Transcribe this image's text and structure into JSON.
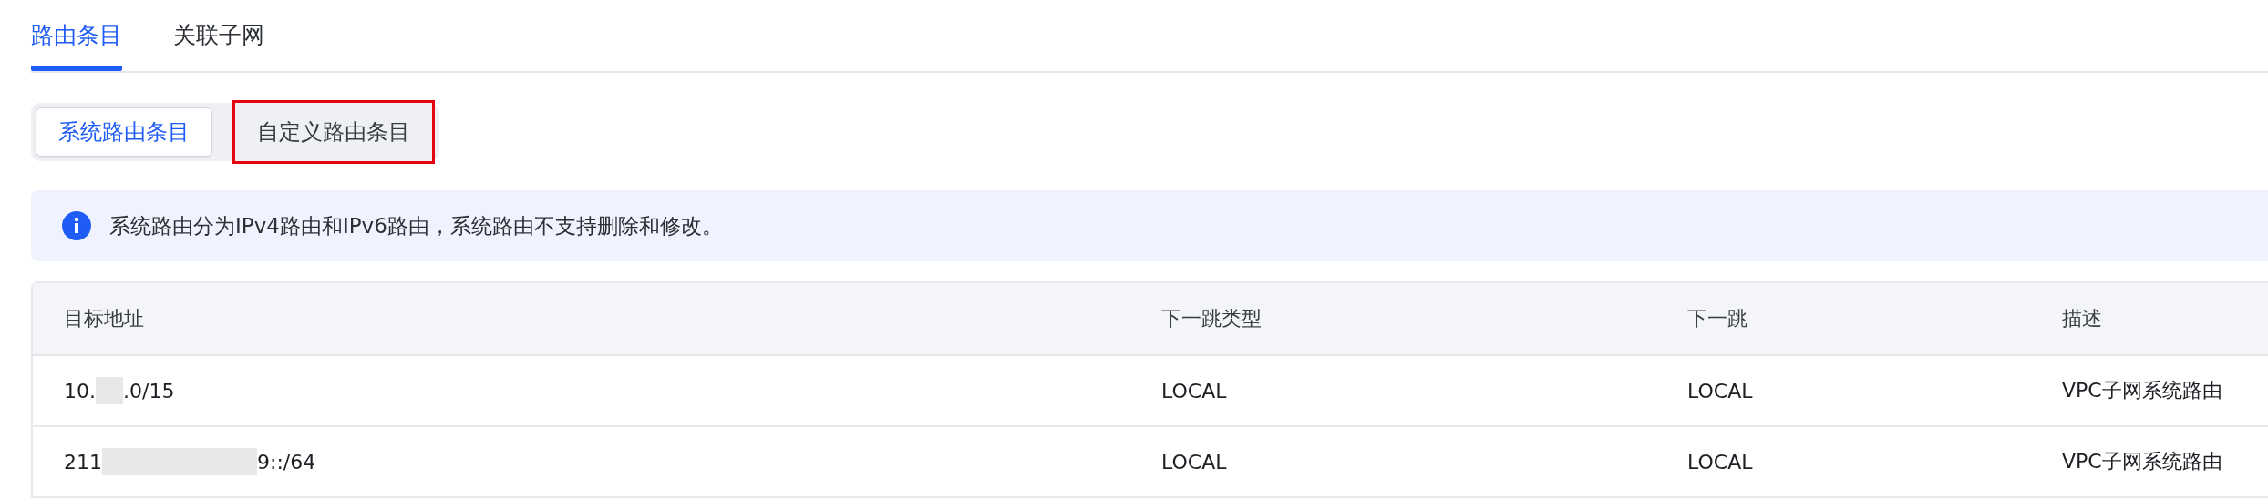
{
  "tabs": [
    {
      "label": "路由条目",
      "selected": true
    },
    {
      "label": "关联子网",
      "selected": false
    }
  ],
  "segments": [
    {
      "label": "系统路由条目",
      "selected": true,
      "outlined": false
    },
    {
      "label": "自定义路由条目",
      "selected": false,
      "outlined": true
    }
  ],
  "notice": {
    "text": "系统路由分为IPv4路由和IPv6路由，系统路由不支持删除和修改。"
  },
  "table": {
    "columns": [
      "目标地址",
      "下一跳类型",
      "下一跳",
      "描述"
    ],
    "rows": [
      {
        "address": {
          "before": "10.",
          "after": ".0/15"
        },
        "next_hop_type": "LOCAL",
        "next_hop": "LOCAL",
        "description": "VPC子网系统路由"
      },
      {
        "address": {
          "before": "211",
          "after": "9::/64"
        },
        "next_hop_type": "LOCAL",
        "next_hop": "LOCAL",
        "description": "VPC子网系统路由"
      }
    ]
  }
}
